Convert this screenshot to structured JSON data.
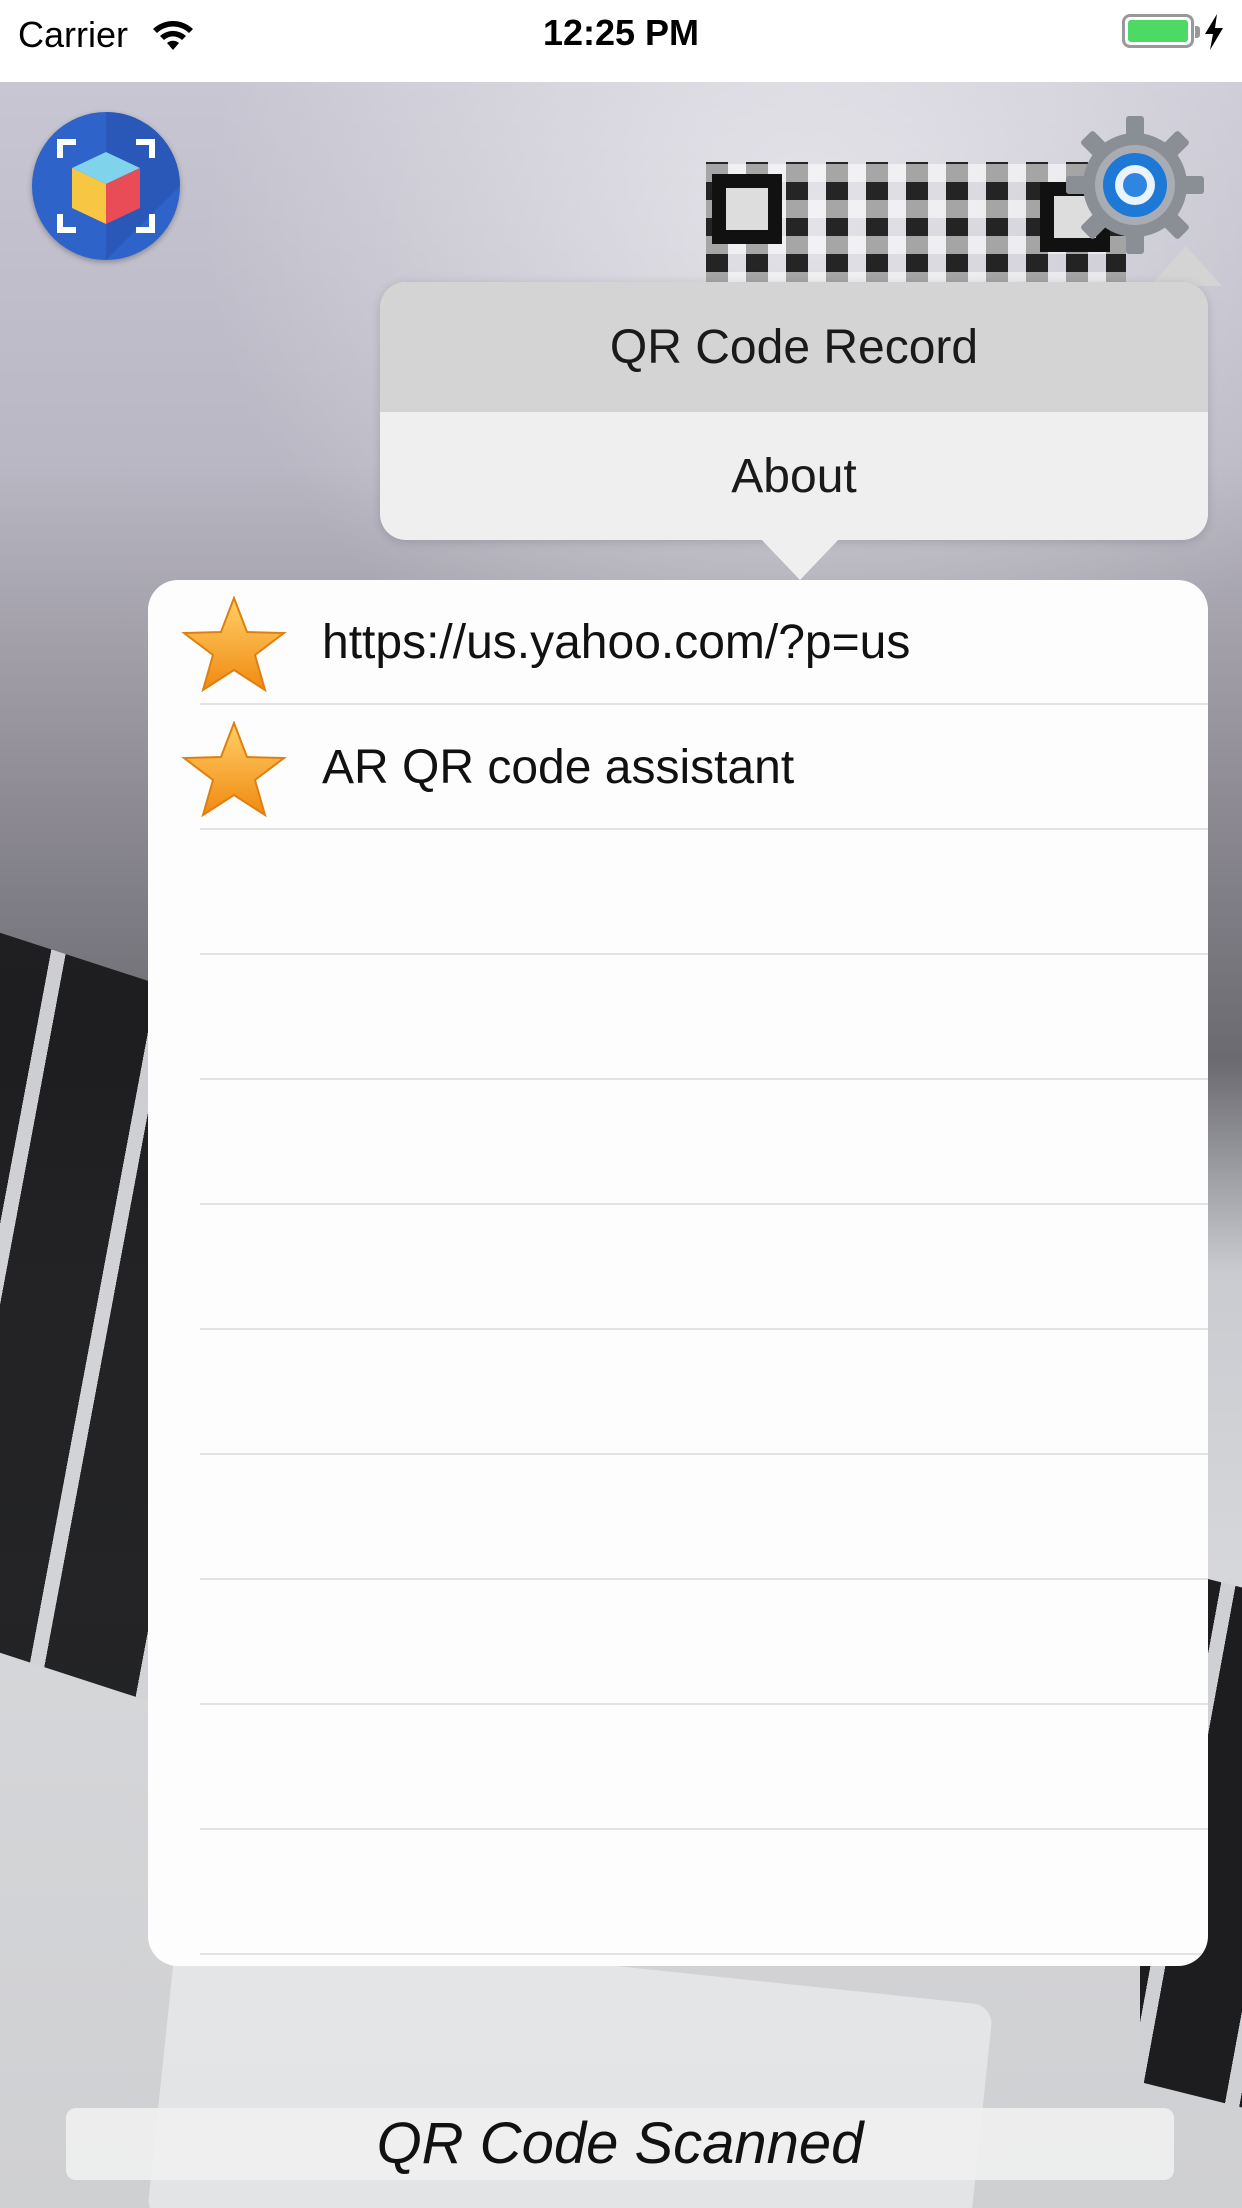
{
  "status_bar": {
    "carrier": "Carrier",
    "time": "12:25 PM",
    "wifi_icon": "wifi-icon",
    "battery_icon": "battery-icon",
    "charging_icon": "charging-bolt-icon",
    "battery_color": "#4cd964"
  },
  "toolbar": {
    "logo_icon": "ar-cube-scanner-icon",
    "settings_icon": "gear-icon"
  },
  "menu": {
    "items": [
      {
        "label": "QR Code Record",
        "selected": true
      },
      {
        "label": "About",
        "selected": false
      }
    ]
  },
  "records": {
    "item_icon": "star-icon",
    "items": [
      {
        "label": "https://us.yahoo.com/?p=us"
      },
      {
        "label": "AR QR code assistant"
      }
    ],
    "empty_rows": 9
  },
  "footer": {
    "status": "QR Code Scanned"
  },
  "colors": {
    "menu_selected_bg": "#d4d4d4",
    "menu_bg": "#efefef",
    "star": "#f6a830",
    "logo_bg": "#2e63c9"
  }
}
